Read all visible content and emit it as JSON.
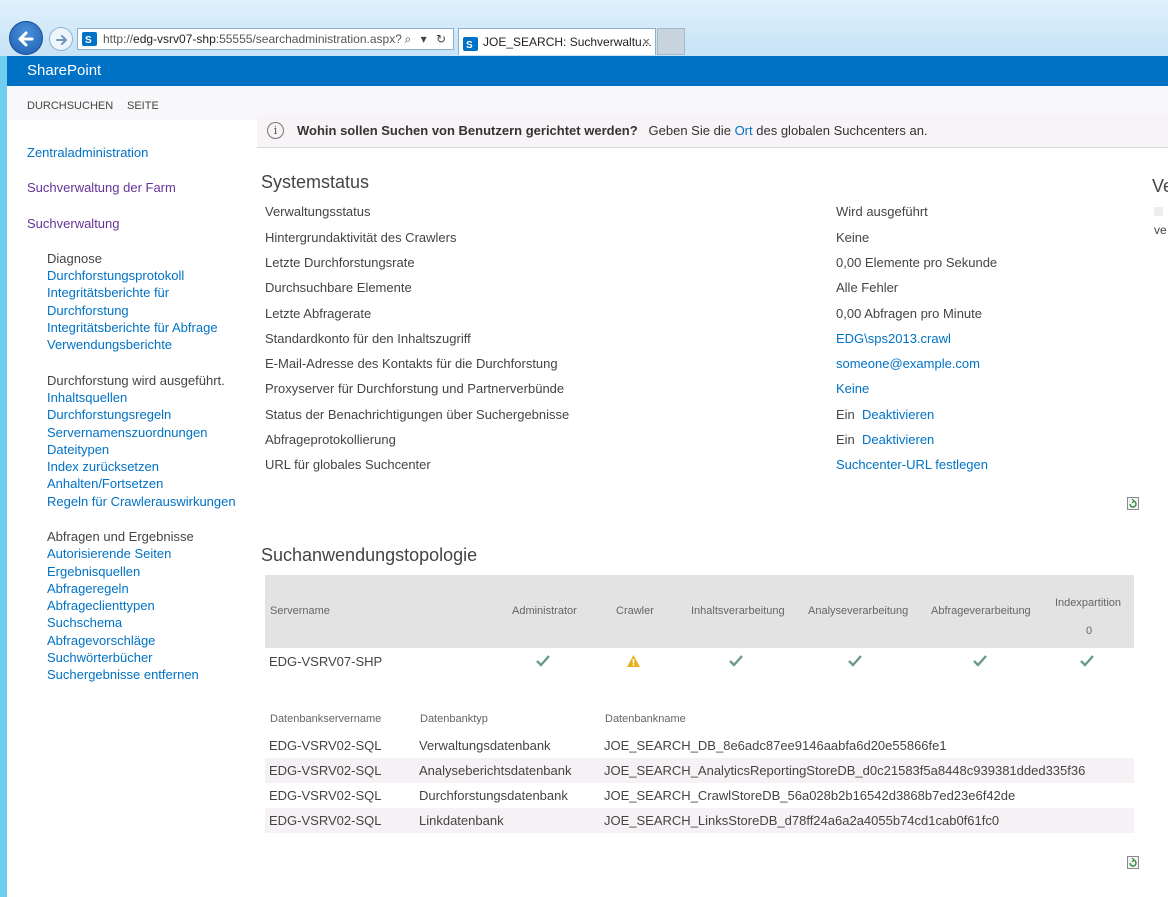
{
  "browser": {
    "url_prefix": "http://",
    "url_host": "edg-vsrv07-shp",
    "url_rest": ":55555/searchadministration.aspx?",
    "address_icons": "⌕ ▾ ↻",
    "tab_title": "JOE_SEARCH: Suchverwaltu...",
    "tab_close": "×"
  },
  "suite": {
    "title": "SharePoint"
  },
  "ribbon": {
    "tabs": [
      "DURCHSUCHEN",
      "SEITE"
    ]
  },
  "notification": {
    "icon": "i",
    "question": "Wohin sollen Suchen von Benutzern gerichtet werden?",
    "text_before": "Geben Sie die",
    "link": "Ort",
    "text_after": "des globalen Suchcenters an."
  },
  "nav": {
    "top": [
      "Zentraladministration",
      "Suchverwaltung der Farm",
      "Suchverwaltung"
    ],
    "groups": [
      {
        "heading": "Diagnose",
        "links": [
          "Durchforstungsprotokoll",
          "Integritätsberichte für",
          "Durchforstung",
          "Integritätsberichte für Abfrage",
          "Verwendungsberichte"
        ]
      },
      {
        "heading": "Durchforstung wird ausgeführt.",
        "links": [
          "Inhaltsquellen",
          "Durchforstungsregeln",
          "Servernamenszuordnungen",
          "Dateitypen",
          "Index zurücksetzen",
          "Anhalten/Fortsetzen",
          "Regeln für Crawlerauswirkungen"
        ]
      },
      {
        "heading": "Abfragen und Ergebnisse",
        "links": [
          "Autorisierende Seiten",
          "Ergebnisquellen",
          "Abfrageregeln",
          "Abfrageclienttypen",
          "Suchschema",
          "Abfragevorschläge",
          "Suchwörterbücher",
          "Suchergebnisse entfernen"
        ]
      }
    ]
  },
  "system_status": {
    "title": "Systemstatus",
    "rows": [
      {
        "label": "Verwaltungsstatus",
        "value": "Wird ausgeführt",
        "link": ""
      },
      {
        "label": "Hintergrundaktivität des Crawlers",
        "value": "Keine",
        "link": ""
      },
      {
        "label": "Letzte Durchforstungsrate",
        "value": "0,00 Elemente pro Sekunde",
        "link": ""
      },
      {
        "label": "Durchsuchbare Elemente",
        "value": "Alle Fehler",
        "link": ""
      },
      {
        "label": "Letzte Abfragerate",
        "value": "0,00 Abfragen pro Minute",
        "link": ""
      },
      {
        "label": "Standardkonto für den Inhaltszugriff",
        "value": "",
        "link": "EDG\\sps2013.crawl"
      },
      {
        "label": "E-Mail-Adresse des Kontakts für die Durchforstung",
        "value": "",
        "link": "someone@example.com"
      },
      {
        "label": "Proxyserver für Durchforstung und Partnerverbünde",
        "value": "",
        "link": "Keine"
      },
      {
        "label": "Status der Benachrichtigungen über Suchergebnisse",
        "value": "Ein",
        "link": "Deaktivieren"
      },
      {
        "label": "Abfrageprotokollierung",
        "value": "Ein",
        "link": "Deaktivieren"
      },
      {
        "label": "URL für globales Suchcenter",
        "value": "",
        "link": "Suchcenter-URL festlegen"
      }
    ]
  },
  "topology": {
    "title": "Suchanwendungstopologie",
    "headers": [
      "Servername",
      "Administrator",
      "Crawler",
      "Inhaltsverarbeitung",
      "Analyseverarbeitung",
      "Abfrageverarbeitung",
      "Indexpartition"
    ],
    "index_partition_number": "0",
    "server": "EDG-VSRV07-SHP",
    "statuses": [
      "ok",
      "warning",
      "ok",
      "ok",
      "ok",
      "ok"
    ],
    "colors": {
      "ok": "#6b9a8a",
      "warning": "#e6b11c"
    }
  },
  "databases": {
    "headers": [
      "Datenbankservername",
      "Datenbanktyp",
      "Datenbankname"
    ],
    "rows": [
      [
        "EDG-VSRV02-SQL",
        "Verwaltungsdatenbank",
        "JOE_SEARCH_DB_8e6adc87ee9146aabfa6d20e55866fe1"
      ],
      [
        "EDG-VSRV02-SQL",
        "Analyseberichtsdatenbank",
        "JOE_SEARCH_AnalyticsReportingStoreDB_d0c21583f5a8448c939381dded335f36"
      ],
      [
        "EDG-VSRV02-SQL",
        "Durchforstungsdatenbank",
        "JOE_SEARCH_CrawlStoreDB_56a028b2b16542d3868b7ed23e6f42de"
      ],
      [
        "EDG-VSRV02-SQL",
        "Linkdatenbank",
        "JOE_SEARCH_LinksStoreDB_d78ff24a6a2a4055b74cd1cab0f61fc0"
      ]
    ]
  },
  "right_clip": {
    "title": "Ve",
    "text": "ve"
  }
}
